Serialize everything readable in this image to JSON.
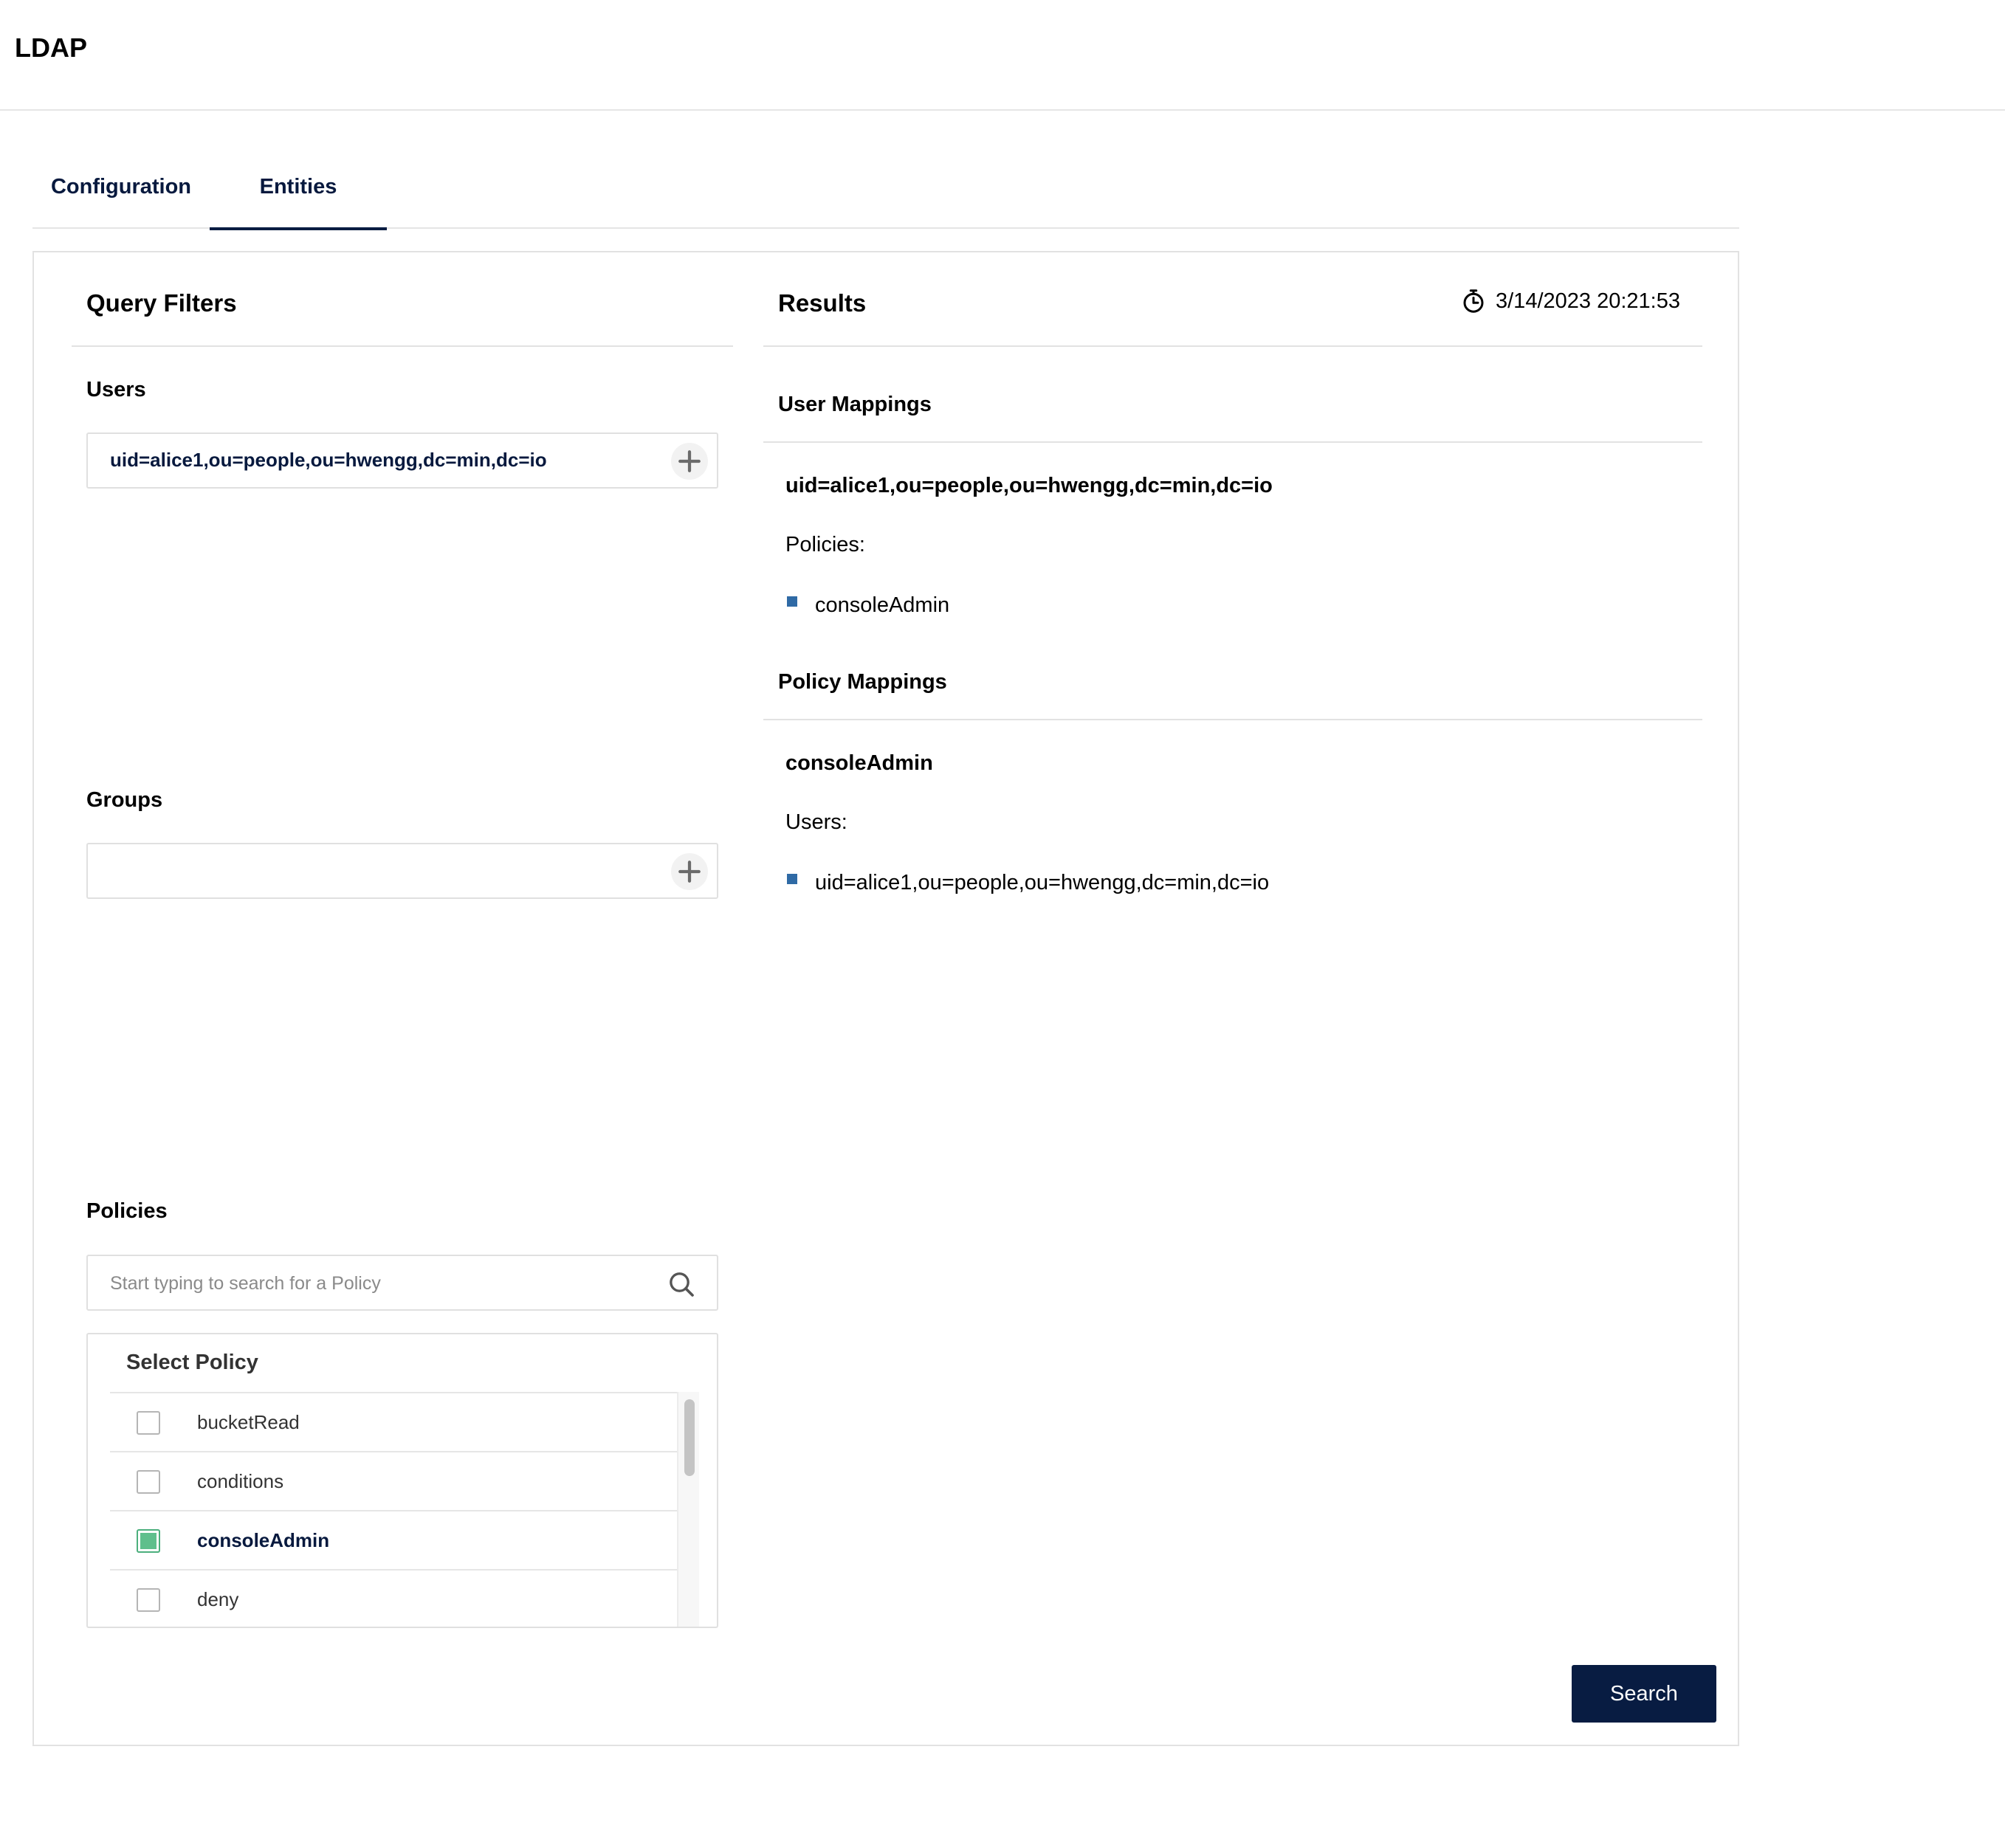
{
  "header": {
    "title": "LDAP"
  },
  "tabs": [
    {
      "label": "Configuration"
    },
    {
      "label": "Entities"
    }
  ],
  "query_filters": {
    "title": "Query Filters",
    "users": {
      "label": "Users",
      "value": "uid=alice1,ou=people,ou=hwengg,dc=min,dc=io"
    },
    "groups": {
      "label": "Groups",
      "value": ""
    },
    "policies": {
      "label": "Policies",
      "search_placeholder": "Start typing to search for a Policy",
      "list_header": "Select  Policy",
      "items": [
        {
          "name": "bucketRead",
          "checked": false
        },
        {
          "name": "conditions",
          "checked": false
        },
        {
          "name": "consoleAdmin",
          "checked": true
        },
        {
          "name": "deny",
          "checked": false
        }
      ]
    }
  },
  "results": {
    "title": "Results",
    "timestamp": "3/14/2023 20:21:53",
    "user_mappings": {
      "label": "User Mappings",
      "entity": "uid=alice1,ou=people,ou=hwengg,dc=min,dc=io",
      "sublabel": "Policies:",
      "items": [
        "consoleAdmin"
      ]
    },
    "policy_mappings": {
      "label": "Policy Mappings",
      "entity": "consoleAdmin",
      "sublabel": "Users:",
      "items": [
        "uid=alice1,ou=people,ou=hwengg,dc=min,dc=io"
      ]
    }
  },
  "actions": {
    "search_label": "Search"
  },
  "colors": {
    "primary": "#081c42",
    "checked": "#5fbf8c",
    "bullet": "#2f6aa5"
  }
}
